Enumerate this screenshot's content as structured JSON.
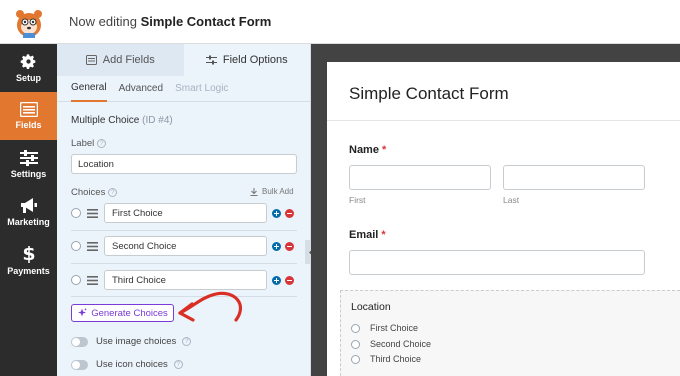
{
  "header": {
    "editing_prefix": "Now editing",
    "form_name": "Simple Contact Form"
  },
  "nav": {
    "items": [
      {
        "label": "Setup",
        "icon": "gear-icon",
        "active": false
      },
      {
        "label": "Fields",
        "icon": "fields-list-icon",
        "active": true
      },
      {
        "label": "Settings",
        "icon": "sliders-icon",
        "active": false
      },
      {
        "label": "Marketing",
        "icon": "megaphone-icon",
        "active": false
      },
      {
        "label": "Payments",
        "icon": "dollar-icon",
        "active": false
      }
    ]
  },
  "panel": {
    "tabs": [
      {
        "label": "Add Fields",
        "active": false
      },
      {
        "label": "Field Options",
        "active": true
      }
    ],
    "subtabs": [
      {
        "label": "General",
        "active": true
      },
      {
        "label": "Advanced",
        "active": false
      },
      {
        "label": "Smart Logic",
        "active": false
      }
    ],
    "field_type": "Multiple Choice",
    "field_id": "(ID #4)",
    "label_caption": "Label",
    "label_value": "Location",
    "choices_caption": "Choices",
    "bulk_add": "Bulk Add",
    "choices": [
      "First Choice",
      "Second Choice",
      "Third Choice"
    ],
    "generate_button": "Generate Choices",
    "toggles": [
      {
        "label": "Use image choices"
      },
      {
        "label": "Use icon choices"
      }
    ]
  },
  "preview": {
    "title": "Simple Contact Form",
    "name_label": "Name",
    "first_sub": "First",
    "last_sub": "Last",
    "email_label": "Email",
    "required_mark": "*",
    "location_label": "Location",
    "location_options": [
      "First Choice",
      "Second Choice",
      "Third Choice"
    ]
  },
  "colors": {
    "accent_orange": "#e27730",
    "ai_purple": "#7a3bd6",
    "annotation_red": "#d93025",
    "add_blue": "#036aab",
    "remove_red": "#d63638"
  }
}
